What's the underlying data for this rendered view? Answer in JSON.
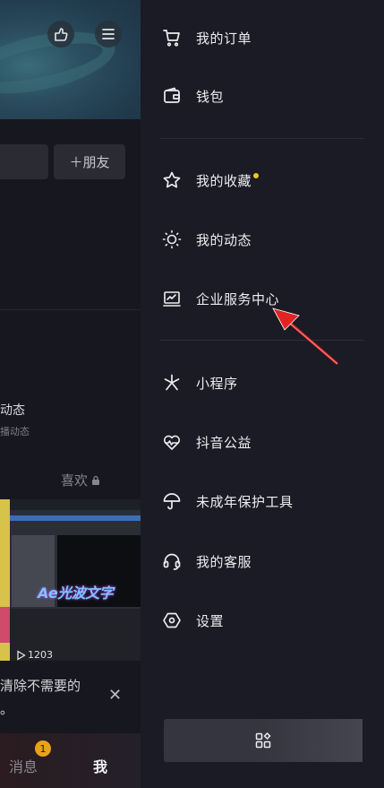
{
  "left_page": {
    "add_friend_label": "＋朋友",
    "dynamic_title": "动态",
    "dynamic_subtitle": "播动态",
    "like_tab_label": "喜欢",
    "thumbnail_text": "Ae光波文字",
    "play_count": "1203",
    "tip_text": "清除不需要的\n。",
    "bottom_tabs": {
      "messages_label": "消息",
      "messages_badge": "1",
      "me_label": "我"
    }
  },
  "drawer": {
    "items": [
      {
        "label": "我的订单",
        "icon": "cart-icon"
      },
      {
        "label": "钱包",
        "icon": "wallet-icon"
      },
      {
        "label": "我的收藏",
        "icon": "star-icon",
        "has_dot": true
      },
      {
        "label": "我的动态",
        "icon": "sun-icon"
      },
      {
        "label": "企业服务中心",
        "icon": "monitor-chart-icon"
      },
      {
        "label": "小程序",
        "icon": "asterisk-icon"
      },
      {
        "label": "抖音公益",
        "icon": "heart-wave-icon"
      },
      {
        "label": "未成年保护工具",
        "icon": "umbrella-icon"
      },
      {
        "label": "我的客服",
        "icon": "headset-icon"
      },
      {
        "label": "设置",
        "icon": "hexagon-settings-icon"
      }
    ],
    "apps_button_icon": "apps-grid-icon"
  },
  "colors": {
    "drawer_bg": "#1a1b24",
    "accent_dot": "#f5c518",
    "annotation_arrow": "#e02424"
  }
}
